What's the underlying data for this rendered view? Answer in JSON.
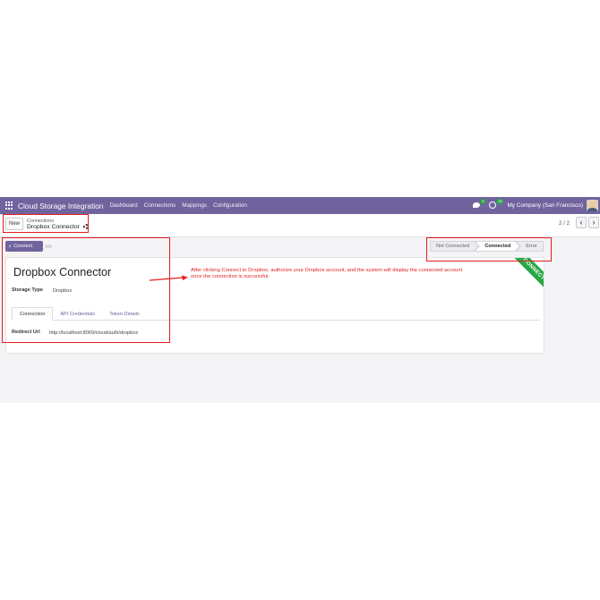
{
  "navbar": {
    "app_name": "Cloud Storage Integration",
    "menu": [
      "Dashboard",
      "Connections",
      "Mappings",
      "Configuration"
    ],
    "chat_badge": "5",
    "activity_badge": "16",
    "company": "My Company (San Francisco)"
  },
  "control_panel": {
    "new_label": "New",
    "breadcrumb_parent": "Connections",
    "breadcrumb_current": "Dropbox Connector",
    "pager_value": "2 / 2",
    "pager_prev": "‹",
    "pager_next": "›"
  },
  "statusbar": {
    "connect_label": "Connect",
    "stages": [
      {
        "label": "Not Connected",
        "active": false
      },
      {
        "label": "Connected",
        "active": true
      },
      {
        "label": "Error",
        "active": false
      }
    ]
  },
  "form": {
    "title": "Dropbox Connector",
    "storage_type_label": "Storage Type",
    "storage_type_value": "Dropbox",
    "tabs": [
      {
        "label": "Connection",
        "active": true
      },
      {
        "label": "API Credentials",
        "active": false
      },
      {
        "label": "Token Details",
        "active": false
      }
    ],
    "redirect_url_label": "Redirect Url",
    "redirect_url_value": "http://localhost:8069/cloud/auth/dropbox",
    "ribbon": "CONNECTED"
  },
  "annotation": {
    "text": "After clicking Connect to Dropbox, authorize your Dropbox account, and the system will display the connected account once the connection is successful."
  },
  "colors": {
    "brand": "#71639e",
    "highlight": "#e41d1d",
    "ribbon": "#28a745"
  }
}
